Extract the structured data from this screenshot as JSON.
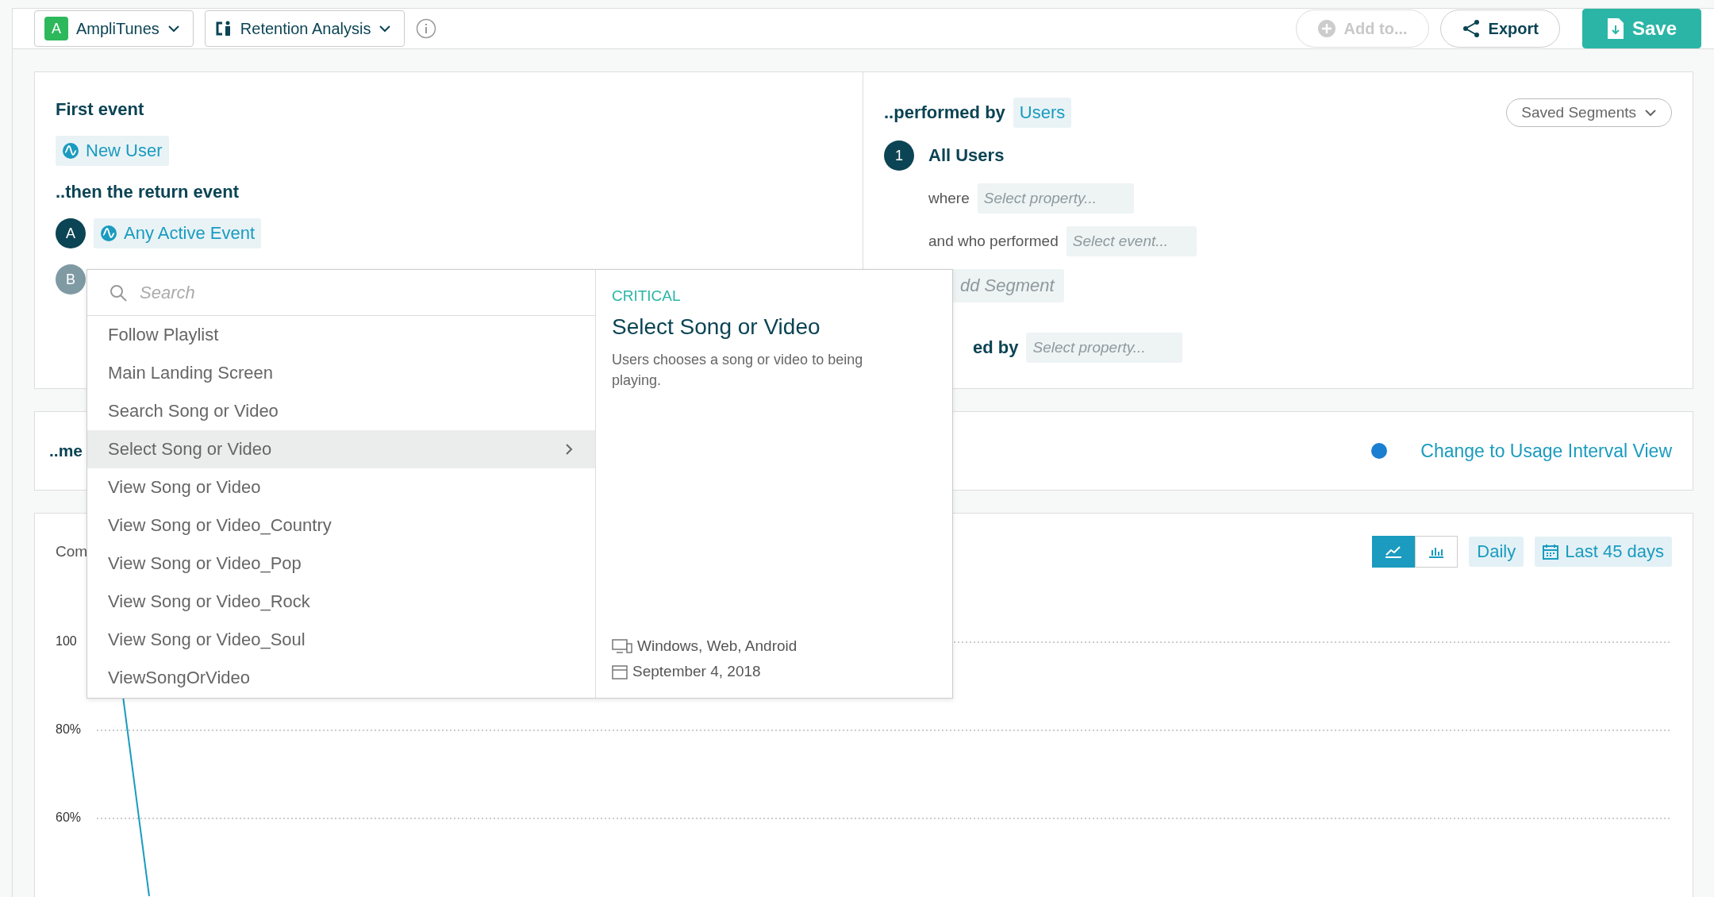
{
  "toolbar": {
    "project": {
      "badge": "A",
      "name": "AmpliTunes"
    },
    "chart_type": "Retention Analysis",
    "buttons": [
      {
        "kind": "add",
        "label": "Add to...",
        "disabled": true
      },
      {
        "kind": "export",
        "label": "Export",
        "disabled": false
      },
      {
        "kind": "save",
        "label": "Save",
        "disabled": false
      }
    ]
  },
  "events": {
    "first_label": "First event",
    "first_event": "New User",
    "return_label": "..then the return event",
    "return_events": [
      {
        "letter": "A",
        "name": "Any Active Event",
        "active": true
      },
      {
        "letter": "B",
        "active": false
      }
    ]
  },
  "segment": {
    "label": "..performed by",
    "entity": "Users",
    "saved_segments": "Saved Segments",
    "segments": [
      {
        "number": "1",
        "name": "All Users",
        "where_label": "where",
        "where_placeholder": "Select property...",
        "performed_label": "and who performed",
        "performed_placeholder": "Select event..."
      }
    ],
    "add_segment": "dd Segment",
    "grouped_label": "ed by",
    "grouped_placeholder": "Select property..."
  },
  "measure": {
    "label": "..me",
    "interval_link": "Change to Usage Interval View"
  },
  "chart": {
    "title": "Com",
    "views": [
      {
        "kind": "line",
        "selected": true
      },
      {
        "kind": "bar",
        "selected": false
      }
    ],
    "interval": "Daily",
    "range": "Last 45 days",
    "y_labels": [
      "100",
      "80%",
      "60%"
    ]
  },
  "dropdown": {
    "placeholder": "Search",
    "items": [
      {
        "label": "Follow Playlist",
        "selected": false
      },
      {
        "label": "Main Landing Screen",
        "selected": false
      },
      {
        "label": "Search Song or Video",
        "selected": false
      },
      {
        "label": "Select Song or Video",
        "selected": true
      },
      {
        "label": "View Song or Video",
        "selected": false
      },
      {
        "label": "View Song or Video_Country",
        "selected": false
      },
      {
        "label": "View Song or Video_Pop",
        "selected": false
      },
      {
        "label": "View Song or Video_Rock",
        "selected": false
      },
      {
        "label": "View Song or Video_Soul",
        "selected": false
      },
      {
        "label": "ViewSongOrVideo",
        "selected": false
      }
    ],
    "detail": {
      "category": "CRITICAL",
      "title": "Select Song or Video",
      "description": "Users chooses a song or video to being playing.",
      "platforms": "Windows, Web, Android",
      "date": "September 4, 2018"
    }
  }
}
